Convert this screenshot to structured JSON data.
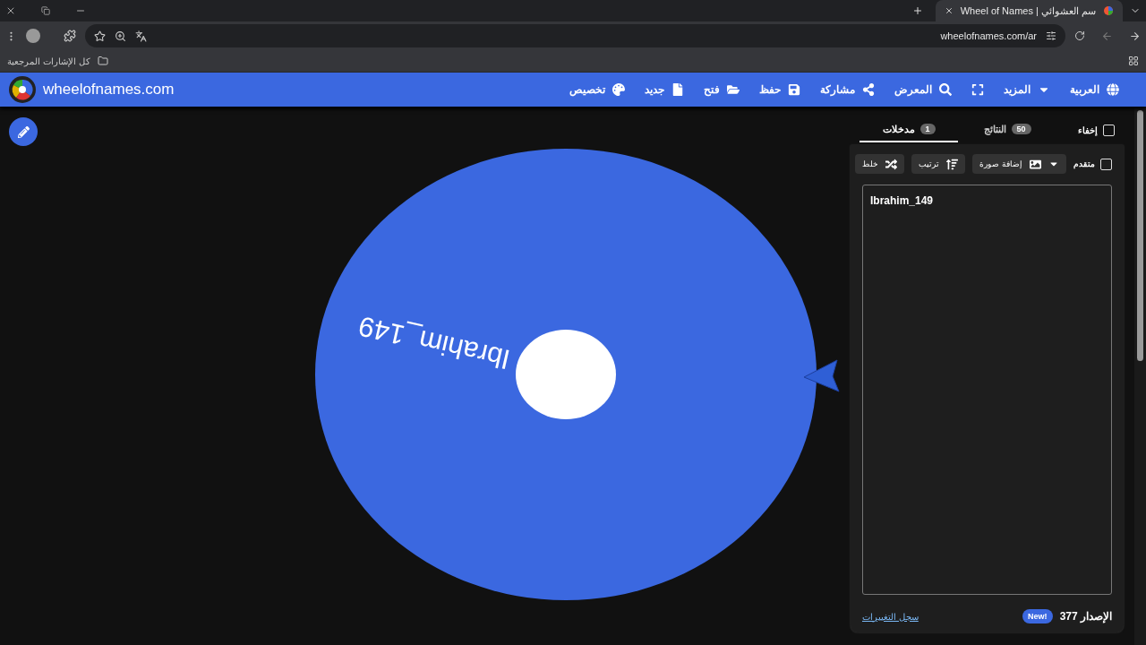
{
  "browser": {
    "tab_title": "Wheel of Names | سم العشوائي",
    "url": "wheelofnames.com/ar",
    "bookmarks_label": "كل الإشارات المرجعية"
  },
  "header": {
    "logo_text": "wheelofnames.com",
    "nav": [
      {
        "kind": "globe",
        "label": "العربية"
      },
      {
        "kind": "caret",
        "label": "المزيد"
      },
      {
        "kind": "fullscreen"
      },
      {
        "kind": "search",
        "label": "المعرض"
      },
      {
        "kind": "share",
        "label": "مشاركة"
      },
      {
        "kind": "save",
        "label": "حفظ"
      },
      {
        "kind": "open",
        "label": "فتح"
      },
      {
        "kind": "new",
        "label": "جديد"
      },
      {
        "kind": "palette",
        "label": "تخصيص"
      }
    ]
  },
  "wheel": {
    "segments": [
      {
        "label": "Ibrahim_149",
        "color": "#3b68e0"
      }
    ]
  },
  "panel": {
    "hide": {
      "label": "إخفاء",
      "checked": false
    },
    "tabs": [
      {
        "label": "النتائج",
        "count": "50",
        "selected": false
      },
      {
        "label": "مدخلات",
        "count": "1",
        "selected": true
      }
    ],
    "advanced": {
      "label": "متقدم",
      "checked": false
    },
    "tools": [
      {
        "kind": "image",
        "label": "إضافة صورة"
      },
      {
        "kind": "sort",
        "label": "ترتيب"
      },
      {
        "kind": "shuffle",
        "label": "خلط"
      }
    ],
    "entries": "Ibrahim_149",
    "version": "الإصدار 377",
    "badge": "New!",
    "changelog": "سجل التغييرات"
  }
}
